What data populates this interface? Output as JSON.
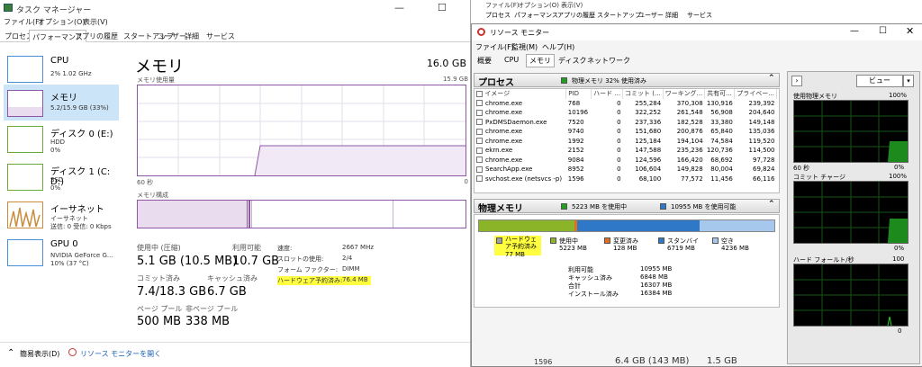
{
  "tm": {
    "title": "タスク マネージャー",
    "menu": [
      "ファイル(F)",
      "オプション(O)",
      "表示(V)"
    ],
    "tabs": [
      "プロセス",
      "パフォーマンス",
      "アプリの履歴",
      "スタートアップ",
      "ユーザー",
      "詳細",
      "サービス"
    ],
    "side": [
      {
        "name": "CPU",
        "sub1": "2% 1.02 GHz",
        "sub2": ""
      },
      {
        "name": "メモリ",
        "sub1": "5.2/15.9 GB (33%)",
        "sub2": ""
      },
      {
        "name": "ディスク 0 (E:)",
        "sub1": "HDD",
        "sub2": "0%"
      },
      {
        "name": "ディスク 1 (C: D:)",
        "sub1": "SSD",
        "sub2": "0%"
      },
      {
        "name": "イーサネット",
        "sub1": "イーサネット",
        "sub2": "送信: 0 受信: 0 Kbps"
      },
      {
        "name": "GPU 0",
        "sub1": "NVIDIA GeForce G...",
        "sub2": "10% (37 °C)"
      }
    ],
    "main": {
      "title": "メモリ",
      "total": "16.0 GB",
      "usage_label": "メモリ使用量",
      "usage_max": "15.9 GB",
      "axis_left": "60 秒",
      "axis_right": "0",
      "comp_label": "メモリ構成",
      "stats": [
        {
          "label": "使用中 (圧縮)",
          "value": "5.1 GB (10.5 MB)"
        },
        {
          "label": "利用可能",
          "value": "10.7 GB"
        },
        {
          "label": "コミット済み",
          "value": "7.4/18.3 GB"
        },
        {
          "label": "キャッシュ済み",
          "value": "6.7 GB"
        },
        {
          "label": "ページ プール",
          "value": "500 MB"
        },
        {
          "label": "非ページ プール",
          "value": "338 MB"
        }
      ],
      "kv": [
        {
          "k": "速度:",
          "v": "2667 MHz"
        },
        {
          "k": "スロットの使用:",
          "v": "2/4"
        },
        {
          "k": "フォーム ファクター:",
          "v": "DIMM"
        },
        {
          "k": "ハードウェア予約済み:",
          "v": "76.4 MB"
        }
      ]
    },
    "footer": {
      "brief": "簡易表示(D)",
      "rm": "リソース モニターを開く"
    }
  },
  "rm_back": {
    "menu": [
      "ファイル(F)",
      "オプション(O)",
      "表示(V)"
    ],
    "tabs": [
      "プロセス",
      "パフォーマンス",
      "アプリの履歴",
      "スタートアップ",
      "ユーザー",
      "詳細",
      "サービス"
    ]
  },
  "rm": {
    "title": "リソース モニター",
    "menu": [
      "ファイル(F)",
      "監視(M)",
      "ヘルプ(H)"
    ],
    "tabs": [
      "概要",
      "CPU",
      "メモリ",
      "ディスク",
      "ネットワーク"
    ],
    "proc_header": "プロセス",
    "proc_status": "物理メモリ 32% 使用済み",
    "cols": [
      "イメージ",
      "PID",
      "ハード ...",
      "コミット (...",
      "ワーキング...",
      "共有可...",
      "プライベー..."
    ],
    "rows": [
      [
        "chrome.exe",
        "768",
        "0",
        "255,284",
        "370,308",
        "130,916",
        "239,392"
      ],
      [
        "chrome.exe",
        "10196",
        "0",
        "322,252",
        "261,548",
        "56,908",
        "204,640"
      ],
      [
        "PxDMSDaemon.exe",
        "7520",
        "0",
        "237,336",
        "182,528",
        "33,380",
        "149,148"
      ],
      [
        "chrome.exe",
        "9740",
        "0",
        "151,680",
        "200,876",
        "65,840",
        "135,036"
      ],
      [
        "chrome.exe",
        "1992",
        "0",
        "125,184",
        "194,104",
        "74,584",
        "119,520"
      ],
      [
        "ekrn.exe",
        "2152",
        "0",
        "147,588",
        "235,236",
        "120,736",
        "114,500"
      ],
      [
        "chrome.exe",
        "9084",
        "0",
        "124,596",
        "166,420",
        "68,692",
        "97,728"
      ],
      [
        "SearchApp.exe",
        "8952",
        "0",
        "106,604",
        "149,828",
        "80,004",
        "69,824"
      ],
      [
        "svchost.exe (netsvcs -p)",
        "1596",
        "0",
        "68,100",
        "77,572",
        "11,456",
        "66,116"
      ]
    ],
    "phys_header": "物理メモリ",
    "phys_used": "5223 MB を使用中",
    "phys_avail": "10955 MB を使用可能",
    "legend": [
      {
        "name": "ハードウェア予約済み",
        "val": "77 MB",
        "color": "#a0a0a0"
      },
      {
        "name": "使用中",
        "val": "5223 MB",
        "color": "#8cb428"
      },
      {
        "name": "変更済み",
        "val": "128 MB",
        "color": "#e07020"
      },
      {
        "name": "スタンバイ",
        "val": "6719 MB",
        "color": "#2f78c8"
      },
      {
        "name": "空き",
        "val": "4236 MB",
        "color": "#a6c8ec"
      }
    ],
    "summary": [
      {
        "k": "利用可能",
        "v": "10955 MB"
      },
      {
        "k": "キャッシュ済み",
        "v": "6848 MB"
      },
      {
        "k": "合計",
        "v": "16307 MB"
      },
      {
        "k": "インストール済み",
        "v": "16384 MB"
      }
    ],
    "view_btn": "ビュー",
    "graphs": [
      {
        "title": "使用物理メモリ",
        "max": "100%",
        "left": "60 秒",
        "right": "0%"
      },
      {
        "title": "コミット チャージ",
        "max": "100%",
        "left": "",
        "right": "0%"
      },
      {
        "title": "ハード フォールト/秒",
        "max": "100",
        "left": "",
        "right": "0"
      }
    ],
    "bottom": [
      "1596",
      "6.4 GB (143 MB)",
      "1.5 GB"
    ]
  },
  "colors": {
    "mem_purple": "#8d57a6",
    "used_green": "#8cb428",
    "highlight": "#ffff40"
  }
}
